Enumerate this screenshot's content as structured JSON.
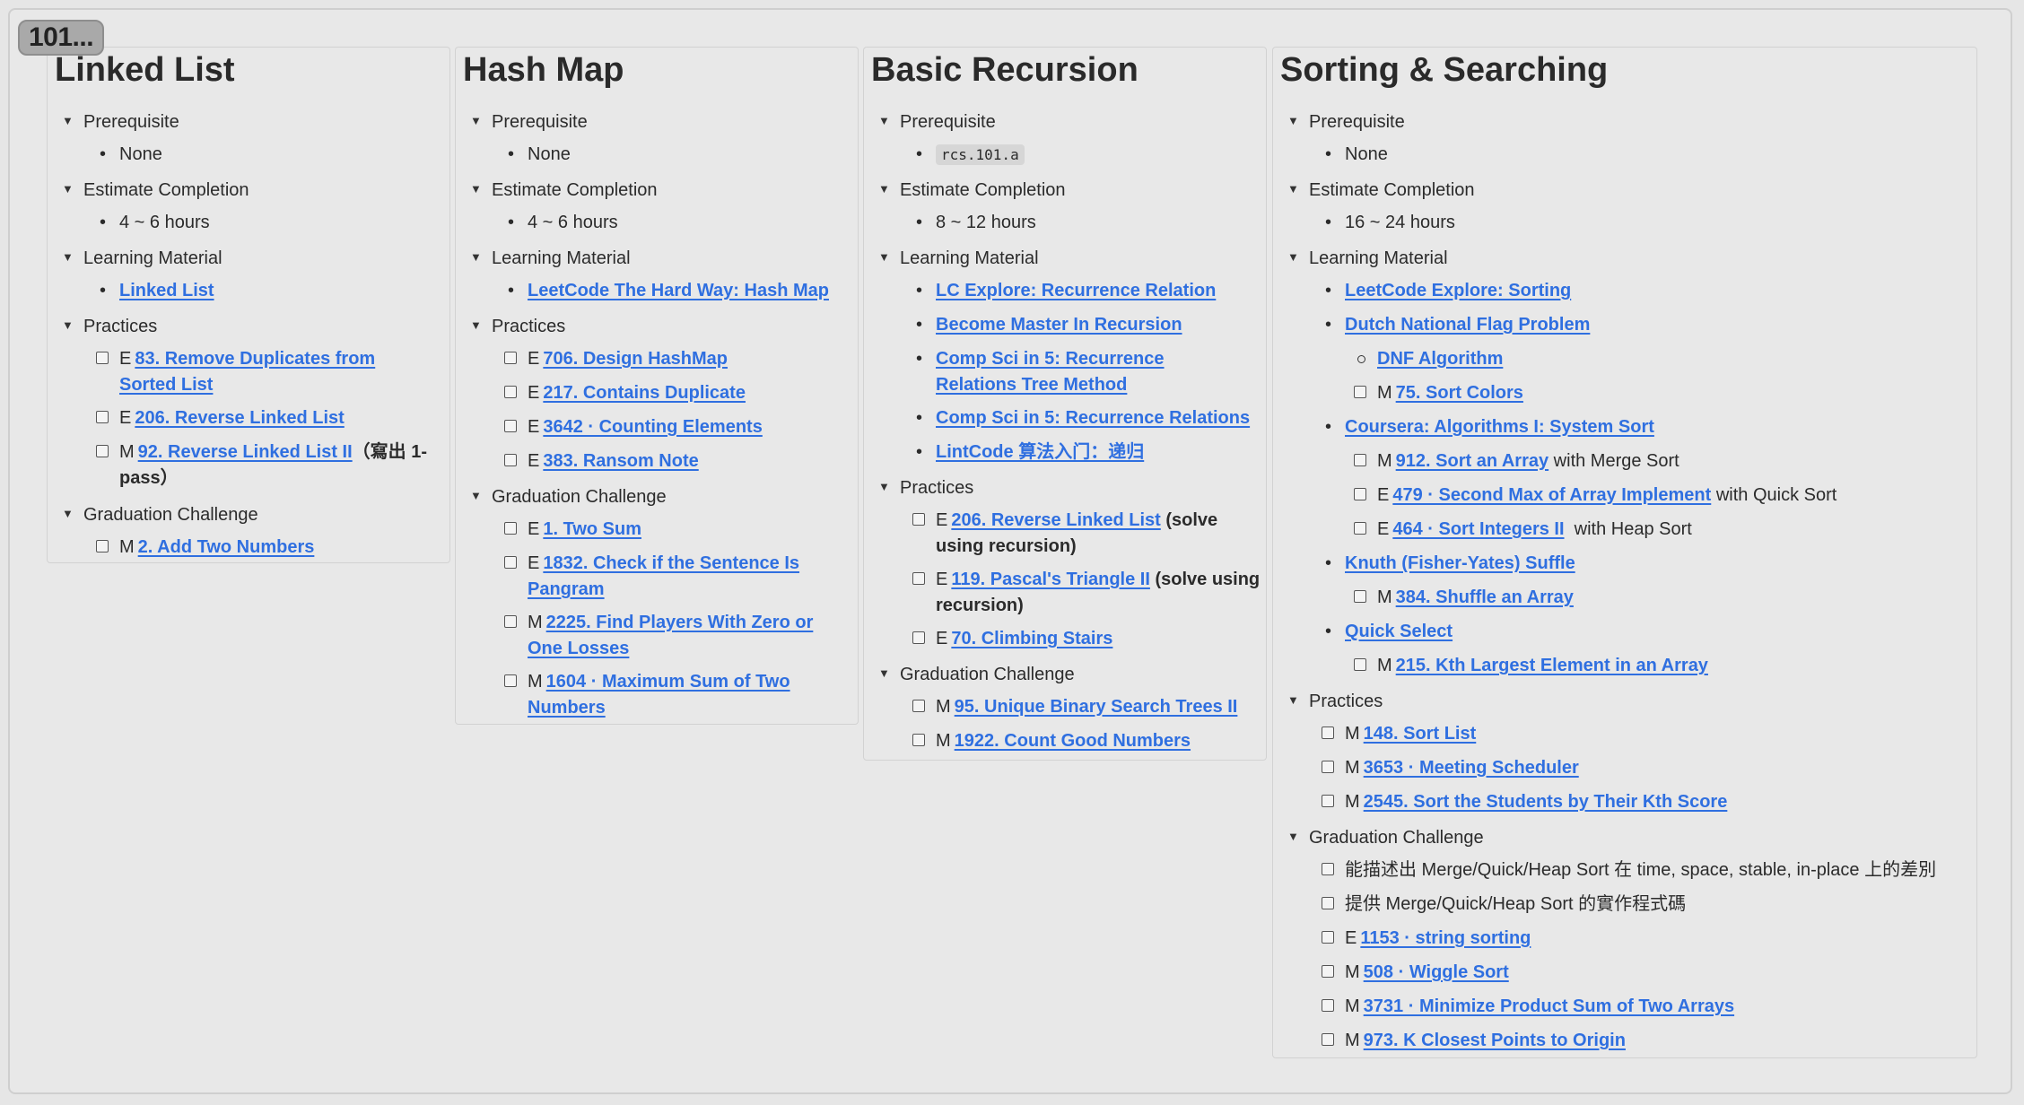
{
  "tag_label": "101...",
  "cards": {
    "linked": {
      "title": "Linked List",
      "prereq_label": "Prerequisite",
      "prereq_value": "None",
      "estimate_label": "Estimate Completion",
      "estimate_value": "4 ~ 6 hours",
      "material_label": "Learning Material",
      "material_1": "Linked List",
      "practices_label": "Practices",
      "p1_diff": "E",
      "p1_link": "83. Remove Duplicates from Sorted List",
      "p2_diff": "E",
      "p2_link": "206. Reverse Linked List",
      "p3_diff": "M",
      "p3_link": "92. Reverse Linked List II",
      "p3_note": "（寫出 1-pass）",
      "grad_label": "Graduation Challenge",
      "g1_diff": "M",
      "g1_link": "2. Add Two Numbers"
    },
    "hash": {
      "title": "Hash Map",
      "prereq_label": "Prerequisite",
      "prereq_value": "None",
      "estimate_label": "Estimate Completion",
      "estimate_value": "4 ~ 6 hours",
      "material_label": "Learning Material",
      "material_1": "LeetCode The Hard Way: Hash Map",
      "practices_label": "Practices",
      "p1_diff": "E",
      "p1_link": "706. Design HashMap",
      "p2_diff": "E",
      "p2_link": "217. Contains Duplicate",
      "p3_diff": "E",
      "p3_link": "3642 · Counting Elements",
      "p4_diff": "E",
      "p4_link": "383. Ransom Note",
      "grad_label": "Graduation Challenge",
      "g1_diff": "E",
      "g1_link": "1. Two Sum",
      "g2_diff": "E",
      "g2_link": "1832. Check if the Sentence Is Pangram",
      "g3_diff": "M",
      "g3_link": "2225. Find Players With Zero or One Losses",
      "g4_diff": "M",
      "g4_link": "1604 · Maximum Sum of Two Numbers"
    },
    "recursion": {
      "title": "Basic Recursion",
      "prereq_label": "Prerequisite",
      "prereq_value": "rcs.101.a",
      "estimate_label": "Estimate Completion",
      "estimate_value": "8 ~ 12 hours",
      "material_label": "Learning Material",
      "m1": "LC Explore: Recurrence Relation",
      "m2": "Become Master In Recursion",
      "m3": "Comp Sci in 5: Recurrence Relations Tree Method",
      "m4": "Comp Sci in 5: Recurrence Relations",
      "m5": "LintCode 算法入门：递归",
      "practices_label": "Practices",
      "p1_diff": "E",
      "p1_link": "206. Reverse Linked List",
      "p1_note": " (solve using recursion)",
      "p2_diff": "E",
      "p2_link": "119. Pascal's Triangle II",
      "p2_note": " (solve using recursion)",
      "p3_diff": "E",
      "p3_link": "70. Climbing Stairs",
      "grad_label": "Graduation Challenge",
      "g1_diff": "M",
      "g1_link": "95. Unique Binary Search Trees II",
      "g2_diff": "M",
      "g2_link": "1922. Count Good Numbers"
    },
    "sorting": {
      "title": "Sorting & Searching",
      "prereq_label": "Prerequisite",
      "prereq_value": "None",
      "estimate_label": "Estimate Completion",
      "estimate_value": "16 ~ 24 hours",
      "material_label": "Learning Material",
      "m1": "LeetCode Explore: Sorting",
      "m2": "Dutch National Flag Problem",
      "m2a": "DNF Algorithm",
      "m2b_diff": "M",
      "m2b_link": "75. Sort Colors",
      "m3": "Coursera: Algorithms I: System Sort",
      "m3a_diff": "M",
      "m3a_link": "912. Sort an Array",
      "m3a_note": " with Merge Sort",
      "m3b_diff": "E",
      "m3b_link": "479 · Second Max of Array Implement",
      "m3b_note": " with Quick Sort",
      "m3c_diff": "E",
      "m3c_link": "464 · Sort Integers II",
      "m3c_note": "  with Heap Sort",
      "m4": "Knuth (Fisher-Yates) Suffle",
      "m4a_diff": "M",
      "m4a_link": "384. Shuffle an Array",
      "m5": "Quick Select",
      "m5a_diff": "M",
      "m5a_link": "215. Kth Largest Element in an Array",
      "practices_label": "Practices",
      "p1_diff": "M",
      "p1_link": "148. Sort List",
      "p2_diff": "M",
      "p2_link": "3653 · Meeting Scheduler",
      "p3_diff": "M",
      "p3_link": "2545. Sort the Students by Their Kth Score",
      "grad_label": "Graduation Challenge",
      "g1_text": "能描述出 Merge/Quick/Heap Sort 在 time, space, stable, in-place 上的差別",
      "g2_text": "提供 Merge/Quick/Heap Sort 的實作程式碼",
      "g3_diff": "E",
      "g3_link": "1153 · string sorting",
      "g4_diff": "M",
      "g4_link": "508 · Wiggle Sort",
      "g5_diff": "M",
      "g5_link": "3731 · Minimize Product Sum of Two Arrays",
      "g6_diff": "M",
      "g6_link": "973. K Closest Points to Origin"
    }
  }
}
